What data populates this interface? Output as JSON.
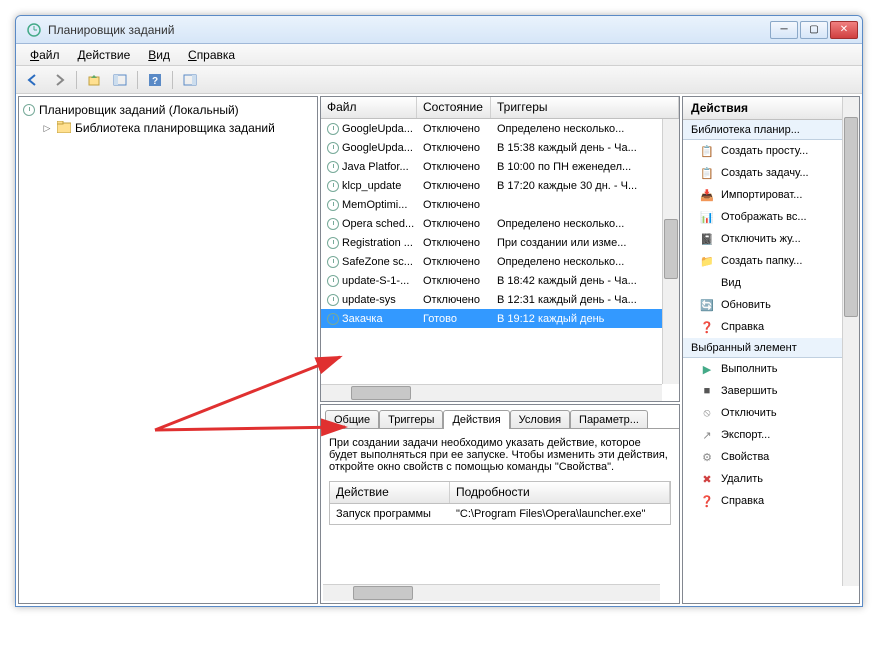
{
  "window": {
    "title": "Планировщик заданий"
  },
  "menu": {
    "file": "Файл",
    "action": "Действие",
    "view": "Вид",
    "help": "Справка"
  },
  "tree": {
    "root": "Планировщик заданий (Локальный)",
    "child": "Библиотека планировщика заданий"
  },
  "columns": {
    "file": "Файл",
    "state": "Состояние",
    "triggers": "Триггеры"
  },
  "tasks": [
    {
      "name": "GoogleUpda...",
      "state": "Отключено",
      "trig": "Определено несколько..."
    },
    {
      "name": "GoogleUpda...",
      "state": "Отключено",
      "trig": "В 15:38 каждый день - Ча..."
    },
    {
      "name": "Java Platfor...",
      "state": "Отключено",
      "trig": "В 10:00 по ПН еженедел..."
    },
    {
      "name": "klcp_update",
      "state": "Отключено",
      "trig": "В 17:20 каждые 30 дн. - Ч..."
    },
    {
      "name": "MemOptimi...",
      "state": "Отключено",
      "trig": ""
    },
    {
      "name": "Opera sched...",
      "state": "Отключено",
      "trig": "Определено несколько..."
    },
    {
      "name": "Registration ...",
      "state": "Отключено",
      "trig": "При создании или изме..."
    },
    {
      "name": "SafeZone sc...",
      "state": "Отключено",
      "trig": "Определено несколько..."
    },
    {
      "name": "update-S-1-...",
      "state": "Отключено",
      "trig": "В 18:42 каждый день - Ча..."
    },
    {
      "name": "update-sys",
      "state": "Отключено",
      "trig": "В 12:31 каждый день - Ча..."
    },
    {
      "name": "Закачка",
      "state": "Готово",
      "trig": "В 19:12 каждый день",
      "selected": true
    }
  ],
  "tabs": {
    "general": "Общие",
    "triggers": "Триггеры",
    "actions": "Действия",
    "conditions": "Условия",
    "settings": "Параметр..."
  },
  "detail": {
    "desc": "При создании задачи необходимо указать действие, которое будет выполняться при ее запуске. Чтобы изменить эти действия, откройте окно свойств с помощью команды \"Свойства\".",
    "col_action": "Действие",
    "col_details": "Подробности",
    "row_action": "Запуск программы",
    "row_details": "\"C:\\Program Files\\Opera\\launcher.exe\""
  },
  "actionspane": {
    "header": "Действия",
    "section1": "Библиотека планир...",
    "items1": [
      "Создать просту...",
      "Создать задачу...",
      "Импортироват...",
      "Отображать вс...",
      "Отключить жу...",
      "Создать папку...",
      "Вид",
      "Обновить",
      "Справка"
    ],
    "section2": "Выбранный элемент",
    "items2": [
      "Выполнить",
      "Завершить",
      "Отключить",
      "Экспорт...",
      "Свойства",
      "Удалить",
      "Справка"
    ]
  }
}
